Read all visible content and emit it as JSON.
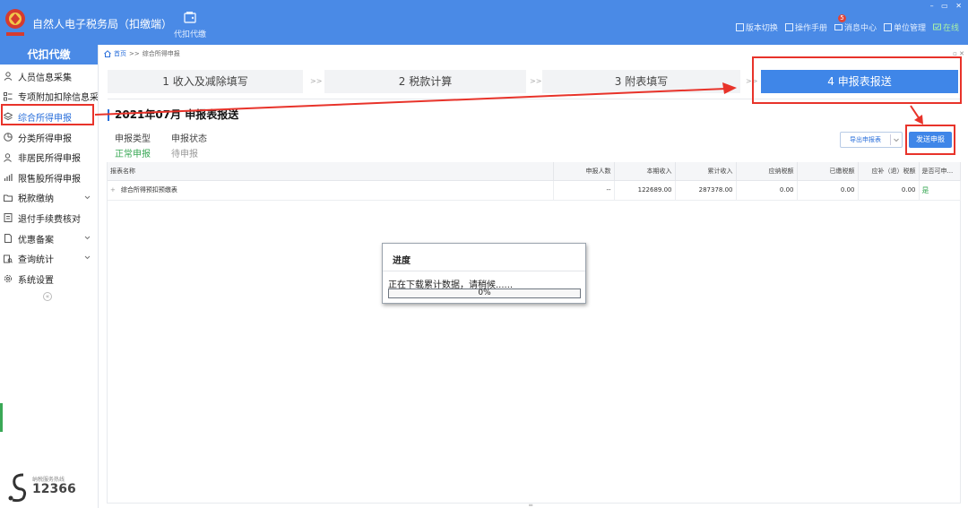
{
  "app": {
    "title": "自然人电子税务局（扣缴端）",
    "module_label": "代扣代缴"
  },
  "top_actions": [
    {
      "label": "版本切换",
      "icon": "switch-icon"
    },
    {
      "label": "操作手册",
      "icon": "manual-icon"
    },
    {
      "label": "消息中心",
      "icon": "message-icon",
      "badge": "5"
    },
    {
      "label": "单位管理",
      "icon": "unit-icon"
    },
    {
      "label": "在线",
      "icon": "online-icon"
    }
  ],
  "sidebar": {
    "header": "代扣代缴",
    "items": [
      {
        "label": "人员信息采集",
        "icon": "person-icon"
      },
      {
        "label": "专项附加扣除信息采",
        "icon": "list-icon"
      },
      {
        "label": "综合所得申报",
        "icon": "layers-icon",
        "active": true
      },
      {
        "label": "分类所得申报",
        "icon": "pie-icon"
      },
      {
        "label": "非居民所得申报",
        "icon": "user-icon"
      },
      {
        "label": "限售股所得申报",
        "icon": "bar-icon"
      },
      {
        "label": "税款缴纳",
        "icon": "folder-icon",
        "expandable": true
      },
      {
        "label": "退付手续费核对",
        "icon": "doc-icon"
      },
      {
        "label": "优惠备案",
        "icon": "page-icon",
        "expandable": true
      },
      {
        "label": "查询统计",
        "icon": "search-chart-icon",
        "expandable": true
      },
      {
        "label": "系统设置",
        "icon": "gear-icon"
      }
    ],
    "hotline_label": "纳税服务热线",
    "hotline_number": "12366"
  },
  "breadcrumb": {
    "home": "首页",
    "separator": ">>",
    "current": "综合所得申报"
  },
  "steps": [
    {
      "label": "1 收入及减除填写"
    },
    {
      "label": "2 税款计算"
    },
    {
      "label": "3 附表填写"
    },
    {
      "label": "4 申报表报送",
      "active": true
    }
  ],
  "step_separator": ">>",
  "report": {
    "title": "2021年07月 申报表报送",
    "type_label": "申报类型",
    "type_value": "正常申报",
    "status_label": "申报状态",
    "status_value": "待申报",
    "export_button": "导出申报表",
    "send_button": "发送申报"
  },
  "table": {
    "columns": [
      "报表名称",
      "申报人数",
      "本期收入",
      "累计收入",
      "应纳税额",
      "已缴税额",
      "应补（退）税额",
      "是否可申..."
    ],
    "rows": [
      [
        "综合所得预扣预缴表",
        "--",
        "122689.00",
        "287378.00",
        "0.00",
        "0.00",
        "0.00",
        "是"
      ]
    ]
  },
  "progress_dialog": {
    "title": "进度",
    "message": "正在下载累计数据，请稍候......",
    "percent_text": "0%",
    "progress": 0
  },
  "colors": {
    "primary": "#4a8ae6",
    "step_active": "#3f86e8",
    "annotation_red": "#e8332a",
    "success_green": "#3aa856"
  }
}
